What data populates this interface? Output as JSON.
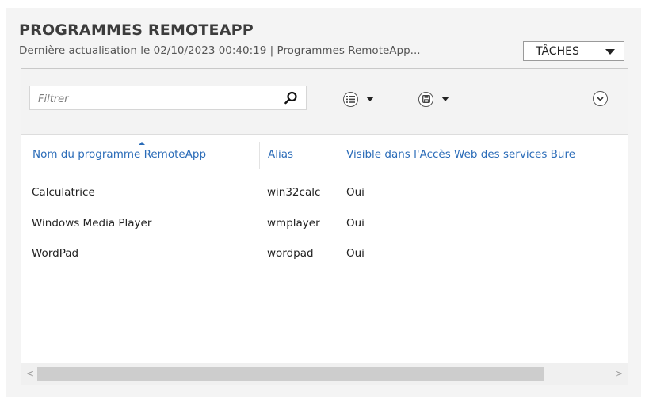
{
  "header": {
    "title": "PROGRAMMES REMOTEAPP",
    "subtitle": "Dernière actualisation le 02/10/2023 00:40:19 | Programmes RemoteApp...",
    "tasks_label": "TÂCHES"
  },
  "toolbar": {
    "filter_placeholder": "Filtrer",
    "icons": [
      "search-icon",
      "list-view-icon",
      "save-query-icon",
      "expand-icon"
    ]
  },
  "table": {
    "columns": [
      "Nom du programme RemoteApp",
      "Alias",
      "Visible dans l'Accès Web des services Bure"
    ],
    "rows": [
      {
        "name": "Calculatrice",
        "alias": "win32calc",
        "visible": "Oui"
      },
      {
        "name": "Windows Media Player",
        "alias": "wmplayer",
        "visible": "Oui"
      },
      {
        "name": "WordPad",
        "alias": "wordpad",
        "visible": "Oui"
      }
    ]
  },
  "scrollbar": {
    "left_arrow": "<",
    "right_arrow": ">"
  },
  "colors": {
    "accent": "#2b6cb8",
    "panel_bg": "#f4f4f4",
    "toolbar_bg": "#f3f3f3"
  }
}
